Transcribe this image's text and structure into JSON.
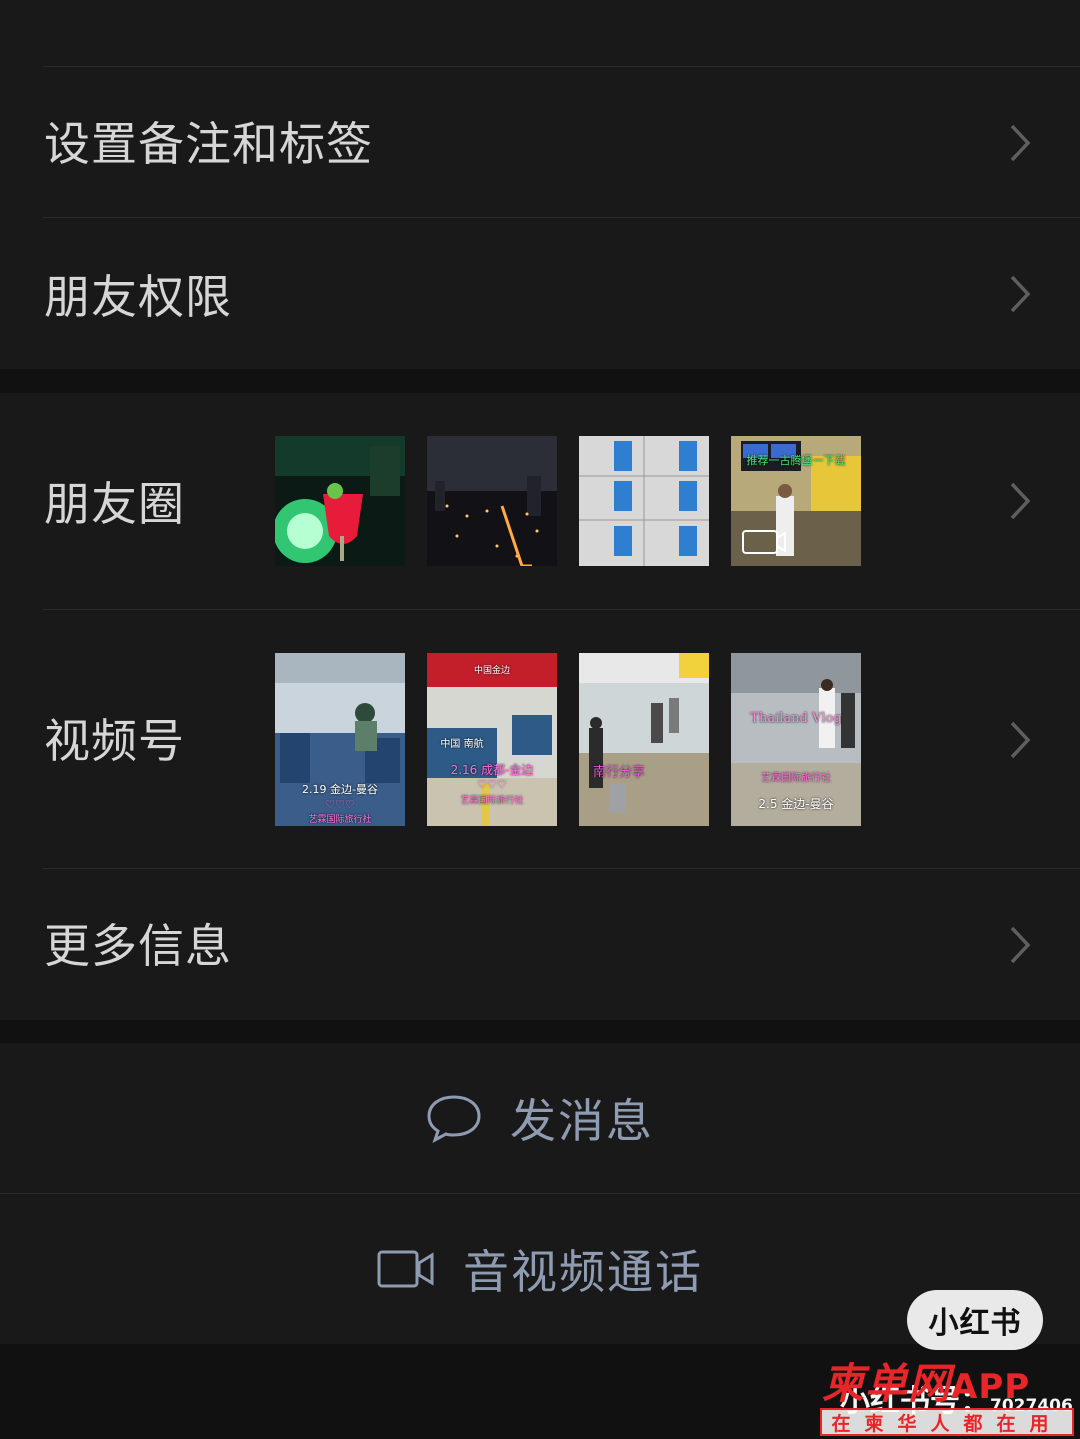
{
  "menu": {
    "remark_tags": "设置备注和标签",
    "friend_permissions": "朋友权限",
    "moments": "朋友圈",
    "channels": "视频号",
    "more_info": "更多信息"
  },
  "moments_thumbs": [
    {
      "desc": "cocktail-night"
    },
    {
      "desc": "city-night"
    },
    {
      "desc": "shelves"
    },
    {
      "desc": "airport-video",
      "text": "推荐一古腾堡一下载"
    }
  ],
  "channel_thumbs": [
    {
      "caption": "2.19 金边-曼谷",
      "hearts": "♡♡♡",
      "sub": "艺霖国际旅行社"
    },
    {
      "sign": "中国金边",
      "desk": "中国 南航",
      "caption": "2.16 成都-金边",
      "hearts": "♡♡♡",
      "sub": "艺霖国际旅行社"
    },
    {
      "caption": "南行分享"
    },
    {
      "title": "Thailand Vlog",
      "sub": "艺霖国际旅行社",
      "caption": "2.5 金边-曼谷"
    }
  ],
  "actions": {
    "send_message": "发消息",
    "av_call": "音视频通话"
  },
  "watermark": {
    "xhs_logo": "小红书",
    "xhs_id_prefix": "小红书号：",
    "xhs_id": "7027406",
    "site_logo": "柬单网",
    "site_app": "APP",
    "site_tagline": "在柬华人都在用"
  },
  "colors": {
    "background": "#111111",
    "panel": "#191919",
    "label": "#d6d6d6",
    "action": "#8e9bb0",
    "watermark_red": "#e8262a"
  }
}
